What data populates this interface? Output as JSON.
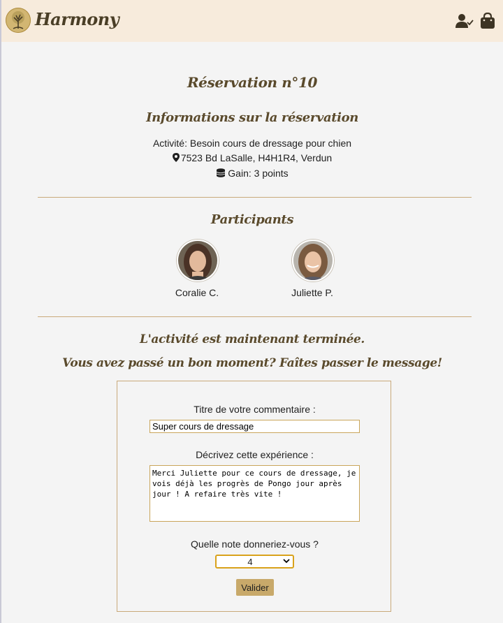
{
  "navbar": {
    "brand": "Harmony",
    "icons": [
      "harmony-tree-logo",
      "user-check-icon",
      "shopping-bag-icon"
    ]
  },
  "page": {
    "title": "Réservation n°10"
  },
  "info": {
    "heading": "Informations sur la réservation",
    "activity": "Activité: Besoin cours de dressage pour chien",
    "address": "7523 Bd LaSalle, H4H1R4, Verdun",
    "gain": "Gain: 3 points",
    "address_icon": "map-marker-icon",
    "gain_icon": "coins-icon"
  },
  "participants": {
    "heading": "Participants",
    "people": [
      {
        "name": "Coralie C."
      },
      {
        "name": "Juliette P."
      }
    ]
  },
  "review": {
    "heading1": "L'activité est maintenant terminée.",
    "heading2": "Vous avez passé un bon moment? Faîtes passer le message!",
    "title_label": "Titre de votre commentaire :",
    "title_value": "Super cours de dressage",
    "desc_label": "Décrivez cette expérience :",
    "desc_value": "Merci Juliette pour ce cours de dressage, je vois déjà les progrès de Pongo jour après jour ! A refaire très vite !",
    "rating_label": "Quelle note donneriez-vous ?",
    "rating_value": "4",
    "submit_label": "Valider"
  },
  "colors": {
    "navbar_bg": "#f7ebdc",
    "accent": "#c8a96a",
    "heading": "#5a4a2c",
    "divider": "#c9a97a"
  }
}
